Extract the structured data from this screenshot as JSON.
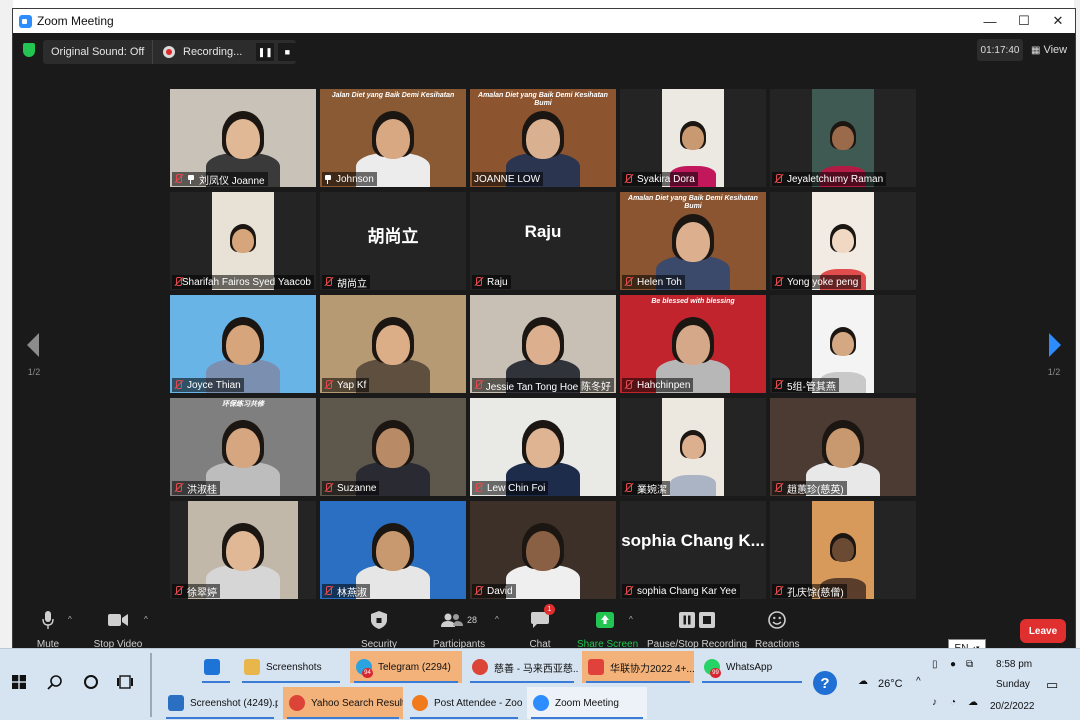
{
  "window": {
    "title": "Zoom Meeting",
    "min": "—",
    "max": "☐",
    "close": "✕"
  },
  "toolbar_top": {
    "original_sound": "Original Sound: Off",
    "recording": "Recording...",
    "timer": "01:17:40",
    "view": "View"
  },
  "gallery": {
    "page": "1/2",
    "tiles": [
      {
        "name": "刘凤仪 Joanne",
        "muted": true,
        "pinned": true,
        "video": true,
        "bg": "#c9c2b8",
        "skin": "#e0b896",
        "shirt": "#3a3a3a"
      },
      {
        "name": "Johnson",
        "muted": false,
        "pinned": true,
        "video": true,
        "active": true,
        "bg": "#8a5a34",
        "skin": "#d8a882",
        "shirt": "#ececec",
        "banner": "Jalan Diet yang Baik Demi Kesihatan"
      },
      {
        "name": "JOANNE LOW",
        "muted": false,
        "pinned": false,
        "video": true,
        "bg": "#8c5530",
        "skin": "#d9b190",
        "shirt": "#2c3550",
        "banner": "Amalan Diet yang Baik Demi Kesihatan Bumi"
      },
      {
        "name": "Syakira Dora",
        "muted": true,
        "pinned": false,
        "video": true,
        "bg": "#ece8e2",
        "skin": "#c99a72",
        "shirt": "#c2185b"
      },
      {
        "name": "Jeyaletchumy Raman",
        "muted": true,
        "pinned": false,
        "video": true,
        "bg": "#3f5a52",
        "skin": "#9b6a4a",
        "shirt": "#b21c44"
      },
      {
        "name": "Sharifah Fairos Syed Yaacob",
        "muted": true,
        "pinned": false,
        "video": true,
        "bg": "#e8e2d6",
        "skin": "#d6a57c",
        "shirt": "#e8e2d6"
      },
      {
        "name": "胡尚立",
        "muted": true,
        "pinned": false,
        "video": false,
        "bigname": "胡尚立"
      },
      {
        "name": "Raju",
        "muted": true,
        "pinned": false,
        "video": false,
        "bigname": "Raju"
      },
      {
        "name": "Helen Toh",
        "muted": true,
        "pinned": false,
        "video": true,
        "bg": "#8a5530",
        "skin": "#dcb08e",
        "shirt": "#3b4a6b",
        "banner": "Amalan Diet yang Baik Demi Kesihatan Bumi"
      },
      {
        "name": "Yong yoke peng",
        "muted": true,
        "pinned": false,
        "video": true,
        "bg": "#f2ebe3",
        "skin": "#f0d8c2",
        "shirt": "#e14d4d"
      },
      {
        "name": "Joyce Thian",
        "muted": true,
        "pinned": false,
        "video": true,
        "bg": "#68b4e6",
        "skin": "#d6a57c",
        "shirt": "#7b8fb0"
      },
      {
        "name": "Yap Kf",
        "muted": true,
        "pinned": false,
        "video": true,
        "bg": "#b59a74",
        "skin": "#dcae88",
        "shirt": "#5e4f3e"
      },
      {
        "name": "Jessie Tan Tong Hoe 陈冬好",
        "muted": true,
        "pinned": false,
        "video": true,
        "bg": "#c8c0b4",
        "skin": "#dcb08e",
        "shirt": "#30333a"
      },
      {
        "name": "Hahchinpen",
        "muted": true,
        "pinned": false,
        "video": true,
        "bg": "#c2242e",
        "skin": "#d6a88a",
        "shirt": "#b7b7b7",
        "banner": "Be blessed with blessing"
      },
      {
        "name": "5组-管其燕",
        "muted": true,
        "pinned": false,
        "video": true,
        "bg": "#f4f4f4",
        "skin": "#d4a882",
        "shirt": "#c9c9c9"
      },
      {
        "name": "洪淑桂",
        "muted": true,
        "pinned": false,
        "video": true,
        "bg": "#7f7f7f",
        "skin": "#d6a680",
        "shirt": "#bdbdbd",
        "banner": "环保练习共修"
      },
      {
        "name": "Suzanne",
        "muted": true,
        "pinned": false,
        "video": true,
        "bg": "#5e574c",
        "skin": "#b98a66",
        "shirt": "#2a2a33"
      },
      {
        "name": "Lew Chin Foi",
        "muted": true,
        "pinned": false,
        "video": true,
        "bg": "#e9eae6",
        "skin": "#dfb492",
        "shirt": "#1d2c4a"
      },
      {
        "name": "業婉潔",
        "muted": true,
        "pinned": false,
        "video": true,
        "bg": "#ece7df",
        "skin": "#dcb08e",
        "shirt": "#aab4c4"
      },
      {
        "name": "趙蕙珍(慈英)",
        "muted": true,
        "pinned": false,
        "video": true,
        "bg": "#4b3b33",
        "skin": "#c8986f",
        "shirt": "#e8e8e8"
      },
      {
        "name": "徐翠婷",
        "muted": true,
        "pinned": false,
        "video": true,
        "bg": "#c2b8aa",
        "skin": "#e0b896",
        "shirt": "#d6d6d6"
      },
      {
        "name": "林燕淑",
        "muted": true,
        "pinned": false,
        "video": true,
        "bg": "#2a6fc1",
        "skin": "#c8986f",
        "shirt": "#e6e6e6"
      },
      {
        "name": "David",
        "muted": true,
        "pinned": false,
        "video": true,
        "bg": "#3d3028",
        "skin": "#8a6044",
        "shirt": "#efefef"
      },
      {
        "name": "sophia Chang Kar Yee",
        "muted": true,
        "pinned": false,
        "video": false,
        "bigname": "sophia Chang K..."
      },
      {
        "name": "孔庆馀(慈僧)",
        "muted": true,
        "pinned": false,
        "video": true,
        "bg": "#d89a5a",
        "skin": "#6b4a34",
        "shirt": "#5a3d2a"
      }
    ]
  },
  "toolbar_bottom": {
    "mute": "Mute",
    "stop_video": "Stop Video",
    "security": "Security",
    "participants": "Participants",
    "participants_count": "28",
    "chat": "Chat",
    "chat_badge": "1",
    "share_screen": "Share Screen",
    "pause_recording": "Pause/Stop Recording",
    "reactions": "Reactions",
    "leave": "Leave",
    "lang": "EN"
  },
  "taskbar": {
    "row1": [
      {
        "label": "",
        "icon": "mail-icon"
      },
      {
        "label": "Screenshots",
        "icon": "folder-icon"
      },
      {
        "label": "Telegram (2294)",
        "icon": "telegram-icon",
        "badge": "94"
      },
      {
        "label": "慈善 - 马来西亚慈...",
        "icon": "chrome-icon"
      },
      {
        "label": "华联协力2022 4+...",
        "icon": "vivaldi-icon"
      },
      {
        "label": "WhatsApp",
        "icon": "whatsapp-icon",
        "badge": "99"
      }
    ],
    "row2": [
      {
        "label": "Screenshot (4249).p...",
        "icon": "photos-icon"
      },
      {
        "label": "Yahoo Search Result...",
        "icon": "chrome-icon"
      },
      {
        "label": "Post Attendee - Zoo...",
        "icon": "firefox-icon"
      },
      {
        "label": "Zoom Meeting",
        "icon": "zoom-icon"
      }
    ],
    "help": "?",
    "temperature": "26°C",
    "time": "8:58 pm",
    "day": "Sunday",
    "date": "20/2/2022"
  }
}
